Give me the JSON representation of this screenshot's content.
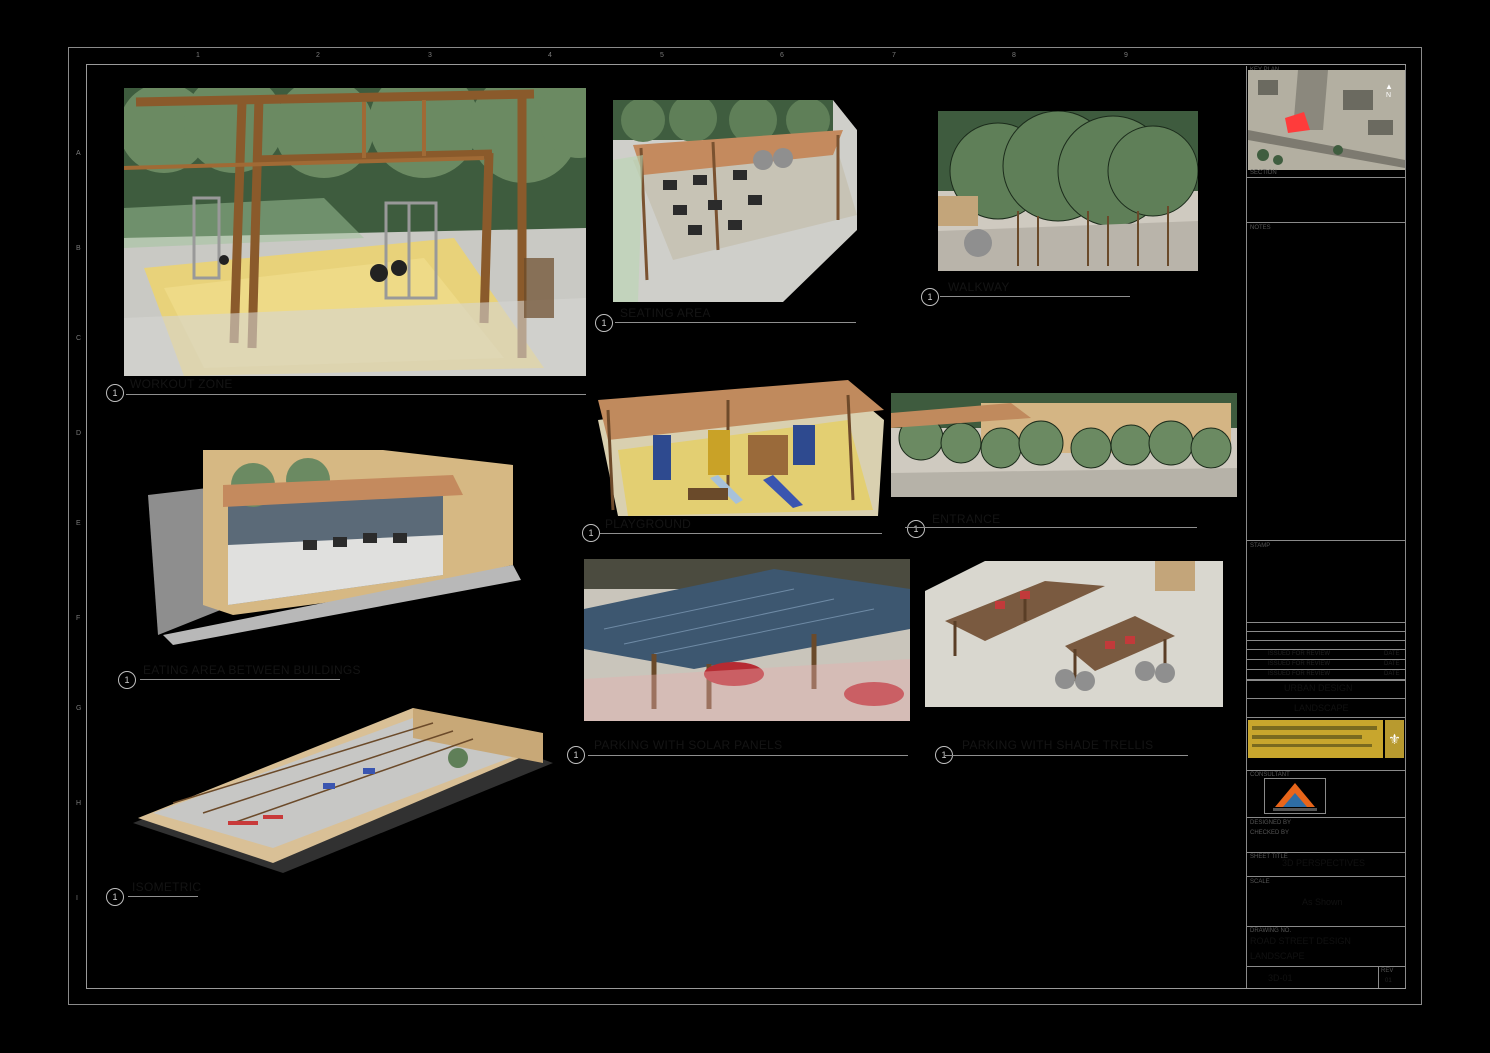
{
  "sheet": {
    "grid_numbers_top": [
      "1",
      "2",
      "3",
      "4",
      "5",
      "6",
      "7",
      "8",
      "9"
    ],
    "grid_letters_left": [
      "A",
      "B",
      "C",
      "D",
      "E",
      "F",
      "G",
      "H",
      "I"
    ]
  },
  "views": [
    {
      "id": "workout-zone",
      "number": "1",
      "caption": "WORKOUT ZONE"
    },
    {
      "id": "seating-area",
      "number": "1",
      "caption": "SEATING AREA"
    },
    {
      "id": "walkway",
      "number": "1",
      "caption": "WALKWAY"
    },
    {
      "id": "playground",
      "number": "1",
      "caption": "PLAYGROUND"
    },
    {
      "id": "entrance",
      "number": "1",
      "caption": "ENTRANCE"
    },
    {
      "id": "eating-area",
      "number": "1",
      "caption": "EATING AREA BETWEEN BUILDINGS"
    },
    {
      "id": "parking-solar",
      "number": "1",
      "caption": "PARKING WITH SOLAR PANELS"
    },
    {
      "id": "parking-shade",
      "number": "1",
      "caption": "PARKING WITH SHADE TRELLIS"
    },
    {
      "id": "isometric",
      "number": "1",
      "caption": "ISOMETRIC"
    }
  ],
  "title_block": {
    "key_plan_label": "KEY PLAN",
    "north_label": "N",
    "section_label": "SECTION",
    "notes_label": "NOTES",
    "stamp_label": "STAMP",
    "revision_rows": [
      {
        "no": "",
        "description": "",
        "date": ""
      },
      {
        "no": "",
        "description": "",
        "date": ""
      },
      {
        "no": "",
        "description": "",
        "date": ""
      },
      {
        "no": "",
        "description": "ISSUED FOR REVIEW",
        "date": "DATE"
      },
      {
        "no": "",
        "description": "ISSUED FOR REVIEW",
        "date": "DATE"
      },
      {
        "no": "",
        "description": "ISSUED FOR REVIEW",
        "date": "DATE"
      }
    ],
    "project_name": "URBAN DESIGN",
    "project_code": "LANDSCAPE",
    "client_box_text": "",
    "consultant_label": "CONSULTANT",
    "designed_label": "DESIGNED BY",
    "checked_label": "CHECKED BY",
    "sheet_title_label": "SHEET TITLE",
    "sheet_title": "3D PERSPECTIVES",
    "scale_label": "SCALE",
    "scale_value": "As Shown",
    "drawing_no_label": "DRAWING NO.",
    "drawing_line1": "ROAD STREET DESIGN",
    "drawing_line2": "LANDSCAPE",
    "sheet_no": "3D-01",
    "rev_label": "REV",
    "rev_value": "01"
  },
  "colors": {
    "background": "#000000",
    "paper_sheet_accent": "#ff3b3b",
    "gold": "#b89a2f"
  }
}
